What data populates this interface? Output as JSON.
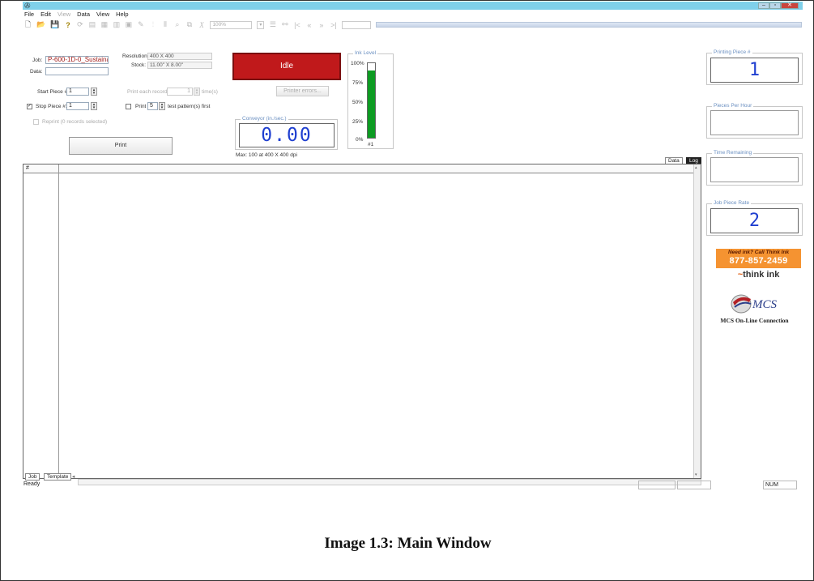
{
  "window": {
    "app_icon": "app-logo-icon",
    "controls": [
      "–",
      "▫",
      "✕"
    ]
  },
  "menu": {
    "file": "File",
    "edit": "Edit",
    "view_disabled": "View",
    "data": "Data",
    "view": "View",
    "help": "Help"
  },
  "toolbar": {
    "zoom": "100%",
    "function_symbol": "X"
  },
  "job": {
    "job_label": "Job:",
    "job_value": "P-600-1D-0_Sustainal",
    "data_label": "Data:",
    "resolution_label": "Resolution:",
    "resolution_value": "400 X 400",
    "stock_label": "Stock:",
    "stock_value": "11.00\" X 8.00\"",
    "start_piece_label": "Start Piece #:",
    "start_piece_value": "1",
    "stop_piece_label": "Stop Piece #:",
    "stop_piece_value": "1",
    "reprint_label": "Reprint (0 records selected)",
    "print_each_label": "Print each record",
    "print_each_value": "1",
    "times_label": "time(s)",
    "print_label": "Print",
    "test_count": "5",
    "test_label": "test pattern(s) first",
    "print_button": "Print"
  },
  "status": {
    "state": "Idle",
    "printer_errors_button": "Printer errors..."
  },
  "conveyor": {
    "title": "Conveyor (in./sec.)",
    "value": "0.00",
    "max_text": "Max: 100 at 400 X 400 dpi"
  },
  "ink": {
    "title": "Ink Level",
    "ticks": [
      "100%",
      "75%",
      "50%",
      "25%",
      "0%"
    ],
    "level_fraction": 0.9,
    "cartridge_label": "#1",
    "color": "#0d9b22"
  },
  "grid": {
    "row_header": "#"
  },
  "tabs": {
    "data": "Data",
    "log": "Log",
    "job": "Job",
    "template": "Template"
  },
  "statusbar": {
    "ready": "Ready",
    "num": "NUM"
  },
  "right_panel": {
    "printing_piece_title": "Printing Piece #",
    "printing_piece_value": "1",
    "pieces_per_hour_title": "Pieces Per Hour",
    "pieces_per_hour_value": "",
    "time_remaining_title": "Time Remaining",
    "time_remaining_value": "",
    "job_piece_rate_title": "Job Piece Rate",
    "job_piece_rate_value": "2"
  },
  "ads": {
    "think_line1": "Need ink? Call Think Ink",
    "think_phone": "877-857-2459",
    "think_logo": "think ink",
    "mcs_logo": "MCS",
    "mcs_caption": "MCS On-Line Connection"
  },
  "caption": "Image 1.3: Main Window",
  "colors": {
    "titlebar": "#7fd0ea",
    "status_idle": "#c0191b",
    "segment_digits": "#1f3fd0",
    "group_title": "#6a8fc0"
  }
}
